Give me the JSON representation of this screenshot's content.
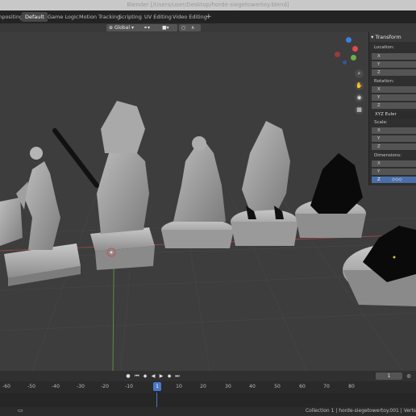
{
  "window": {
    "title": "Blender [/Users/user/Desktop/horde-siegetowertoy.blend]"
  },
  "workspaces": {
    "tabs": [
      {
        "label": "mpositing",
        "active": false
      },
      {
        "label": "Default",
        "active": true
      },
      {
        "label": "Game Logic",
        "active": false
      },
      {
        "label": "Motion Tracking",
        "active": false
      },
      {
        "label": "Scripting",
        "active": false
      },
      {
        "label": "UV Editing",
        "active": false
      },
      {
        "label": "Video Editing",
        "active": false
      }
    ],
    "add_label": "+"
  },
  "viewport_header": {
    "orientation": "Global"
  },
  "npanel": {
    "title": "Transform",
    "location_label": "Location:",
    "rotation_label": "Rotation:",
    "rotation_mode": "XYZ Euler",
    "scale_label": "Scale:",
    "dimensions_label": "Dimensions:",
    "axes": [
      "X",
      "Y",
      "Z"
    ],
    "dimensions_z_value": "◇◇◇"
  },
  "gizmo": {
    "colors": {
      "x": "#e24a4a",
      "y": "#6ab04c",
      "z": "#3b7fe0"
    }
  },
  "timeline": {
    "current_frame": "1",
    "ruler_ticks": [
      "-60",
      "-50",
      "-40",
      "-30",
      "-20",
      "-10",
      "10",
      "20",
      "30",
      "40",
      "50",
      "60",
      "70",
      "80"
    ],
    "ruler_current": "1"
  },
  "status": {
    "text": "Collection 1 | horde-siegetowertoy.001 | Verts"
  }
}
